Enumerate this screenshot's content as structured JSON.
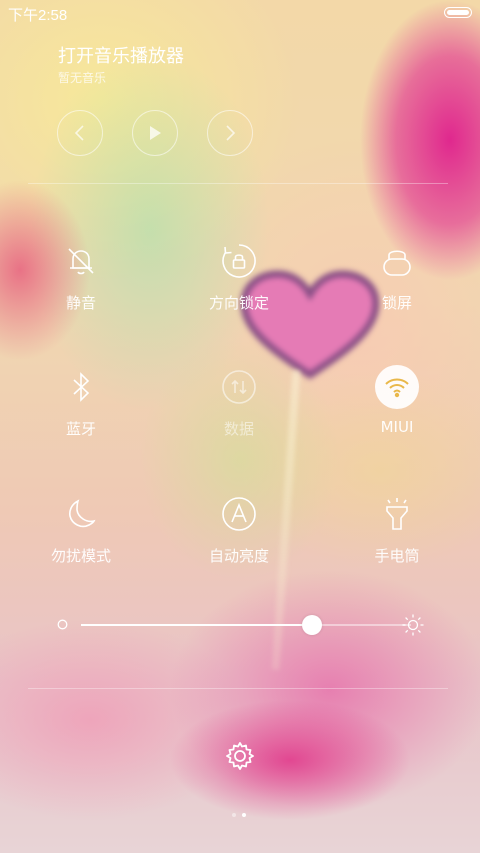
{
  "status_bar": {
    "time": "下午2:58",
    "battery_level": 1.0
  },
  "music": {
    "title": "打开音乐播放器",
    "subtitle": "暂无音乐",
    "controls": {
      "prev_icon": "chevron-left-icon",
      "play_icon": "play-icon",
      "next_icon": "chevron-right-icon"
    }
  },
  "toggles": [
    {
      "label": "静音",
      "icon": "bell-off-icon",
      "active": false
    },
    {
      "label": "方向锁定",
      "icon": "rotation-lock-icon",
      "active": false
    },
    {
      "label": "锁屏",
      "icon": "lock-icon",
      "active": false
    },
    {
      "label": "蓝牙",
      "icon": "bluetooth-icon",
      "active": false
    },
    {
      "label": "数据",
      "icon": "mobile-data-icon",
      "active": false
    },
    {
      "label": "MIUI",
      "icon": "wifi-icon",
      "active": true
    },
    {
      "label": "勿扰模式",
      "icon": "moon-icon",
      "active": false
    },
    {
      "label": "自动亮度",
      "icon": "auto-brightness-icon",
      "active": false
    },
    {
      "label": "手电筒",
      "icon": "flashlight-icon",
      "active": false
    }
  ],
  "brightness": {
    "level": 0.7,
    "min_icon": "brightness-low-icon",
    "max_icon": "brightness-high-icon"
  },
  "footer": {
    "settings_icon": "gear-icon",
    "page_count": 2,
    "current_page": 2
  },
  "colors": {
    "accent_wifi": "#e9b84a",
    "wallpaper_pink": "#e0288e"
  }
}
